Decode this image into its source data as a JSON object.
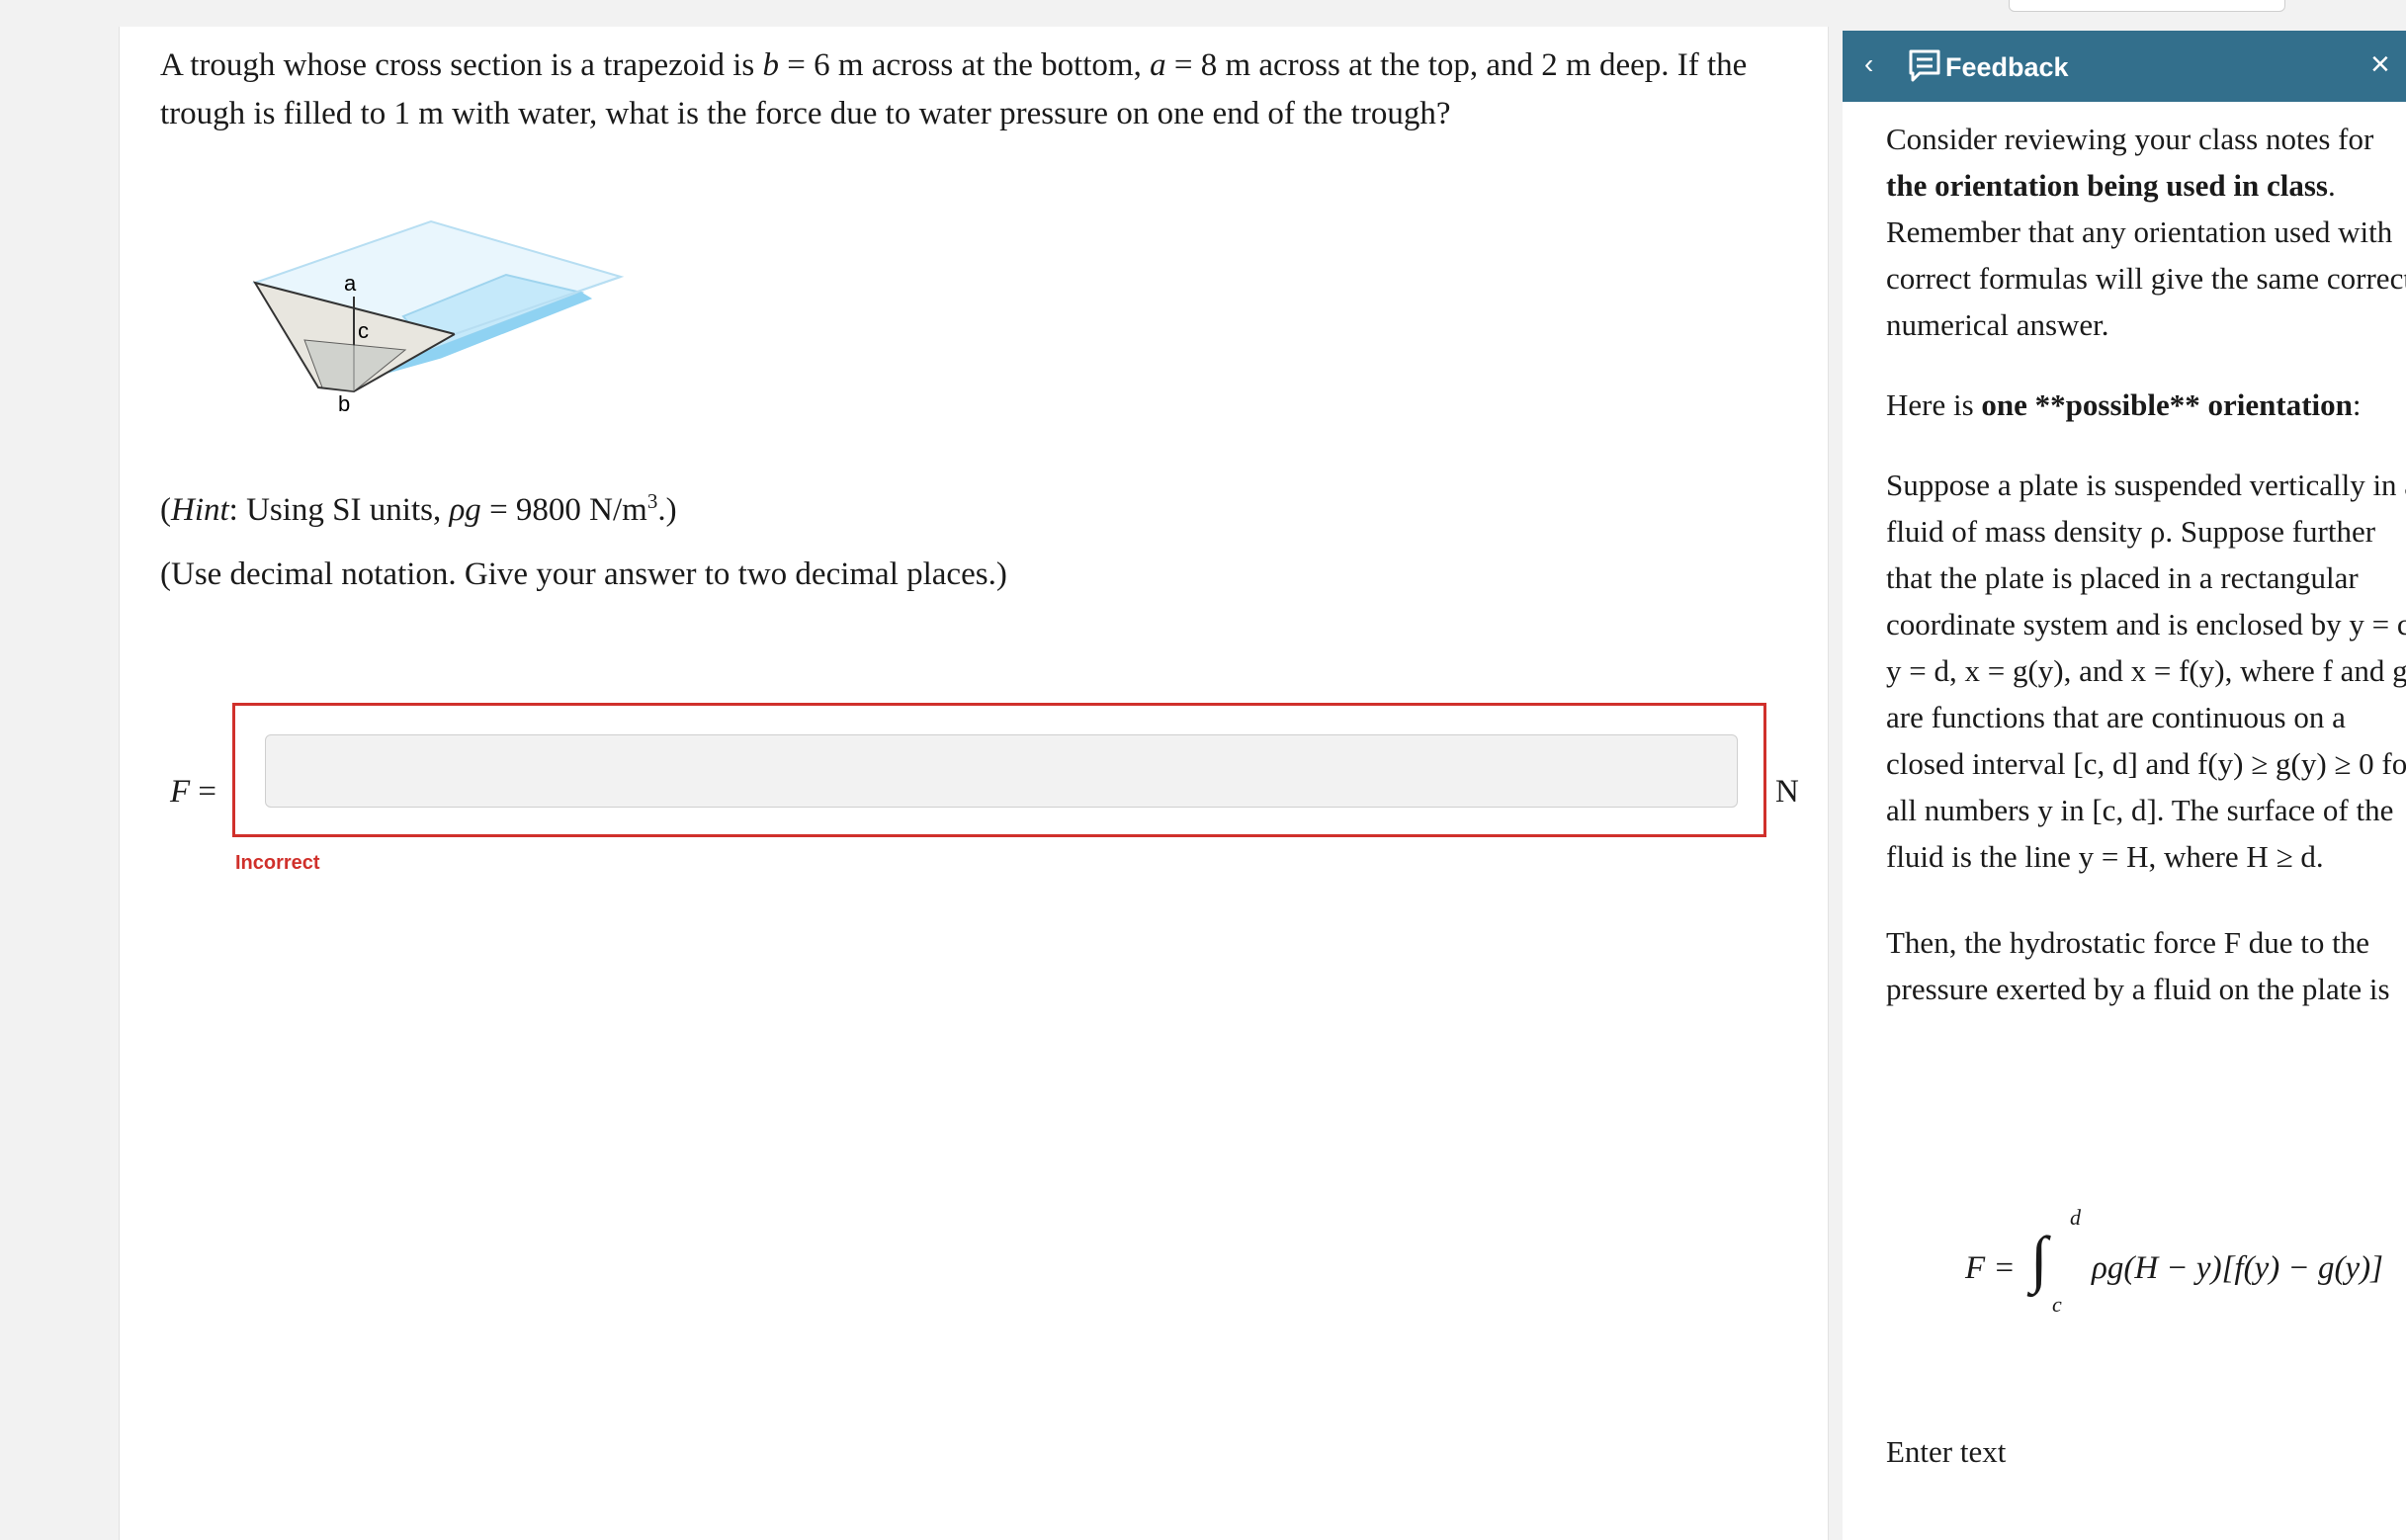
{
  "problem": {
    "seg1": "A trough whose cross section is a trapezoid is",
    "var_b": "b",
    "seg2": "= 6 m across at the bottom,",
    "var_a": "a",
    "seg3": "= 8 m across at the top, and 2 m deep. If the trough is filled to 1 m with water, what is the force due to water pressure on one end of the trough?"
  },
  "diagram": {
    "label_a": "a",
    "label_c": "c",
    "label_b": "b",
    "colors": {
      "water": "#a6dcf5",
      "end_face": "#e6e3dc",
      "outline": "#9fd0ea"
    }
  },
  "hint": {
    "open": "(",
    "hint_word": "Hint",
    "middle": ": Using SI units,",
    "rho_g": "ρg",
    "value": "= 9800 N/m",
    "exponent": "3",
    "close": ".)"
  },
  "instructions": "(Use decimal notation. Give your answer to two decimal places.)",
  "answer": {
    "label_var": "F",
    "label_eq": "=",
    "value": "",
    "unit": "N",
    "status": "Incorrect",
    "status_color": "#d0302b"
  },
  "feedback": {
    "title": "Feedback",
    "header_color": "#336f8c",
    "p1_a": "Consider reviewing your class notes for",
    "p1_bold": "the orientation being used in class",
    "p1_b": ". Remember that any orientation used with correct formulas will give the same correct numerical answer.",
    "p2_a": "Here is",
    "p2_bold": "one **possible** orientation",
    "p2_b": ":",
    "p3": "Suppose a plate is suspended vertically in a fluid of mass density ρ. Suppose further that the plate is placed in a rectangular coordinate system and is enclosed by y = c, y = d, x = g(y), and x = f(y), where f and g are functions that are continuous on a closed interval [c, d] and f(y) ≥ g(y) ≥ 0 for all numbers y in [c, d]. The surface of the fluid is the line y = H, where H ≥ d.",
    "p4": "Then, the hydrostatic force F due to the pressure exerted by a fluid on the plate is",
    "formula_lhs": "F =",
    "formula_int": "∫",
    "formula_upper": "d",
    "formula_lower": "c",
    "formula_integrand": "ρg(H − y)[f(y) − g(y)]",
    "enter_text": "Enter text"
  }
}
